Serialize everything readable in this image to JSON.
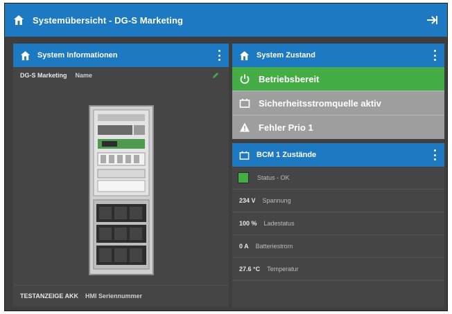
{
  "header": {
    "title": "Systemübersicht - DG-S Marketing",
    "home_icon": "home-icon",
    "nav_icon": "arrow-right-icon",
    "color": "#1d79c2"
  },
  "system_info": {
    "title": "System Informationen",
    "system_name": "DG-S Marketing",
    "system_name_label": "Name",
    "footer_value": "TESTANZEIGE AKK",
    "footer_label": "HMI Seriennummer"
  },
  "system_state": {
    "title": "System Zustand",
    "rows": [
      {
        "label": "Betriebsbereit",
        "icon": "power-icon",
        "color": "#45ad45"
      },
      {
        "label": "Sicherheitsstromquelle aktiv",
        "icon": "battery-icon",
        "color": "#9e9e9e"
      },
      {
        "label": "Fehler Prio 1",
        "icon": "warning-icon",
        "color": "#9e9e9e"
      }
    ]
  },
  "bcm": {
    "title": "BCM 1 Zustände",
    "status_label": "Status - OK",
    "status_color": "#45ad45",
    "rows": [
      {
        "value": "234 V",
        "label": "Spannung"
      },
      {
        "value": "100 %",
        "label": "Ladestatus"
      },
      {
        "value": "0 A",
        "label": "Batteriestrom"
      },
      {
        "value": "27.6 °C",
        "label": "Temperatur"
      }
    ]
  }
}
